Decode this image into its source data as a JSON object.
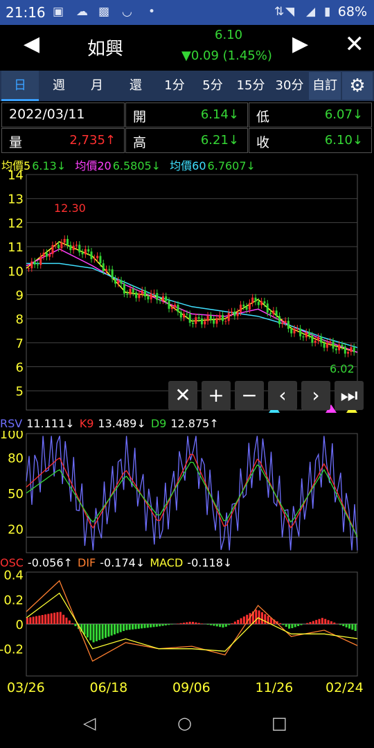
{
  "status_bar": {
    "time": "21:16",
    "battery": "68%"
  },
  "header": {
    "stock_name": "如興",
    "price": "6.10",
    "change": "▼0.09 (1.45%)"
  },
  "tabs": [
    "日",
    "週",
    "月",
    "還",
    "1分",
    "5分",
    "15分",
    "30分"
  ],
  "tab_custom": "自訂",
  "info": {
    "date": "2022/03/11",
    "open_label": "開",
    "open_value": "6.14↓",
    "low_label": "低",
    "low_value": "6.07↓",
    "volume_label": "量",
    "volume_value": "2,735↑",
    "high_label": "高",
    "high_value": "6.21↓",
    "close_label": "收",
    "close_value": "6.10↓"
  },
  "ma_legend": {
    "ma5_label": "均價5",
    "ma5_value": "6.13↓",
    "ma20_label": "均價20",
    "ma20_value": "6.5805↓",
    "ma60_label": "均價60",
    "ma60_value": "6.7607↓"
  },
  "kd_legend": {
    "rsv_label": "RSV",
    "rsv_value": "11.111↓",
    "k_label": "K9",
    "k_value": "13.489↓",
    "d_label": "D9",
    "d_value": "12.875↑"
  },
  "macd_legend": {
    "osc_label": "OSC",
    "osc_value": "-0.056↑",
    "dif_label": "DIF",
    "dif_value": "-0.174↓",
    "macd_label": "MACD",
    "macd_value": "-0.118↓"
  },
  "colors": {
    "up": "#ff3030",
    "down": "#35d635",
    "ma5": "#ffff33",
    "ma20": "#ff40ff",
    "ma60": "#40e0ff",
    "axis_label": "#ffff33"
  },
  "chart_data": [
    {
      "type": "line",
      "title": "",
      "x": [
        "03/26",
        "06/18",
        "09/06",
        "11/26",
        "02/24"
      ],
      "ylim": [
        4.2,
        14
      ],
      "yticks": [
        14,
        13,
        12,
        11,
        10,
        9,
        8,
        7,
        6,
        5
      ],
      "annotations": [
        "12.30",
        "6.02"
      ],
      "series": [
        {
          "name": "均價5",
          "values": [
            10.1,
            11.2,
            10.6,
            9.1,
            8.9,
            7.9,
            8.0,
            8.8,
            7.6,
            7.0,
            6.6
          ]
        },
        {
          "name": "均價20",
          "values": [
            10.2,
            10.9,
            10.2,
            9.4,
            8.8,
            8.2,
            8.1,
            8.4,
            7.7,
            7.1,
            6.6
          ]
        },
        {
          "name": "均價60",
          "values": [
            10.3,
            10.3,
            10.1,
            9.5,
            8.9,
            8.5,
            8.3,
            8.1,
            7.7,
            7.2,
            6.8
          ]
        }
      ]
    },
    {
      "type": "line",
      "title": "",
      "ylim": [
        0,
        100
      ],
      "yticks": [
        100,
        80,
        50,
        20
      ],
      "series": [
        {
          "name": "RSV",
          "values": [
            60,
            90,
            10,
            80,
            20,
            95,
            10,
            90,
            15,
            85,
            11
          ]
        },
        {
          "name": "K9",
          "values": [
            55,
            80,
            20,
            70,
            25,
            85,
            20,
            80,
            20,
            75,
            13
          ]
        },
        {
          "name": "D9",
          "values": [
            50,
            70,
            25,
            65,
            30,
            78,
            25,
            75,
            25,
            70,
            13
          ]
        }
      ]
    },
    {
      "type": "bar",
      "title": "",
      "ylim": [
        -0.42,
        0.42
      ],
      "yticks": [
        0.4,
        0.2,
        0,
        -0.2
      ],
      "series": [
        {
          "name": "OSC",
          "values": [
            0.05,
            0.1,
            -0.15,
            -0.05,
            -0.02,
            0.02,
            -0.03,
            0.12,
            -0.04,
            0.05,
            -0.056
          ]
        },
        {
          "name": "DIF",
          "values": [
            0.1,
            0.35,
            -0.3,
            -0.15,
            -0.2,
            -0.18,
            -0.25,
            0.15,
            -0.1,
            -0.05,
            -0.174
          ]
        },
        {
          "name": "MACD",
          "values": [
            0.05,
            0.25,
            -0.2,
            -0.12,
            -0.2,
            -0.2,
            -0.22,
            0.05,
            -0.08,
            -0.08,
            -0.118
          ]
        }
      ]
    }
  ]
}
